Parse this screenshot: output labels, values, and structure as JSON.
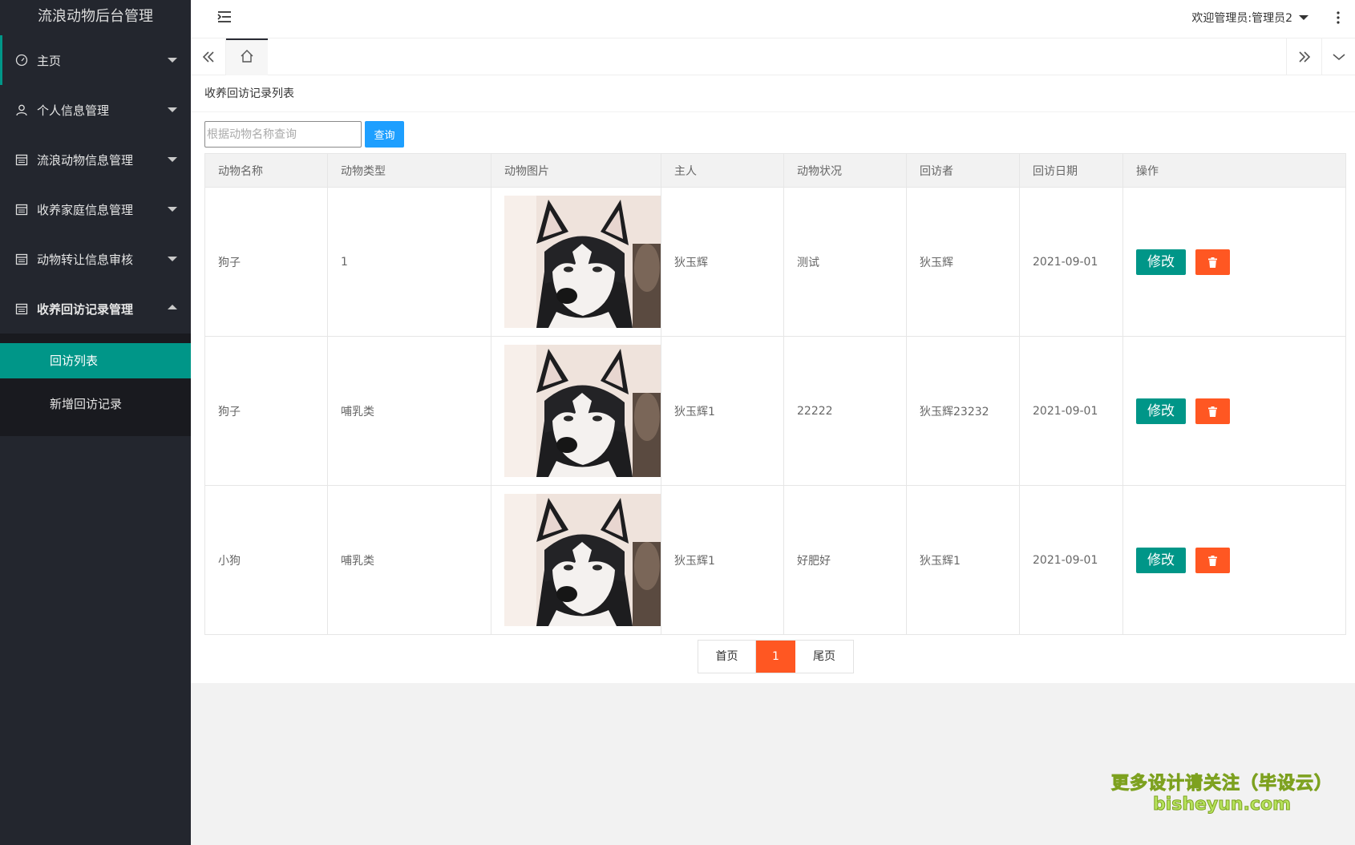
{
  "app": {
    "title": "流浪动物后台管理"
  },
  "sidebar": {
    "items": [
      {
        "label": "主页",
        "icon": "gauge-icon"
      },
      {
        "label": "个人信息管理",
        "icon": "user-icon"
      },
      {
        "label": "流浪动物信息管理",
        "icon": "calendar-icon"
      },
      {
        "label": "收养家庭信息管理",
        "icon": "calendar-icon"
      },
      {
        "label": "动物转让信息审核",
        "icon": "calendar-icon"
      },
      {
        "label": "收养回访记录管理",
        "icon": "calendar-icon"
      }
    ],
    "submenu": [
      {
        "label": "回访列表"
      },
      {
        "label": "新增回访记录"
      }
    ]
  },
  "header": {
    "welcome": "欢迎管理员:管理员2"
  },
  "panel": {
    "title": "收养回访记录列表"
  },
  "search": {
    "placeholder": "根据动物名称查询",
    "button": "查询"
  },
  "table": {
    "columns": [
      "动物名称",
      "动物类型",
      "动物图片",
      "主人",
      "动物状况",
      "回访者",
      "回访日期",
      "操作"
    ],
    "rows": [
      {
        "name": "狗子",
        "type": "1",
        "owner": "狄玉辉",
        "status": "测试",
        "visitor": "狄玉辉",
        "date": "2021-09-01"
      },
      {
        "name": "狗子",
        "type": "哺乳类",
        "owner": "狄玉辉1",
        "status": "22222",
        "visitor": "狄玉辉23232",
        "date": "2021-09-01"
      },
      {
        "name": "小狗",
        "type": "哺乳类",
        "owner": "狄玉辉1",
        "status": "好肥好",
        "visitor": "狄玉辉1",
        "date": "2021-09-01"
      }
    ],
    "edit_label": "修改"
  },
  "pager": {
    "first": "首页",
    "current": "1",
    "last": "尾页"
  },
  "watermark": {
    "line1": "更多设计请关注（毕设云）",
    "line2": "bisheyun.com"
  },
  "colors": {
    "sidebar_bg": "#23262e",
    "accent": "#009688",
    "danger": "#ff5722",
    "primary": "#1e9fff"
  }
}
